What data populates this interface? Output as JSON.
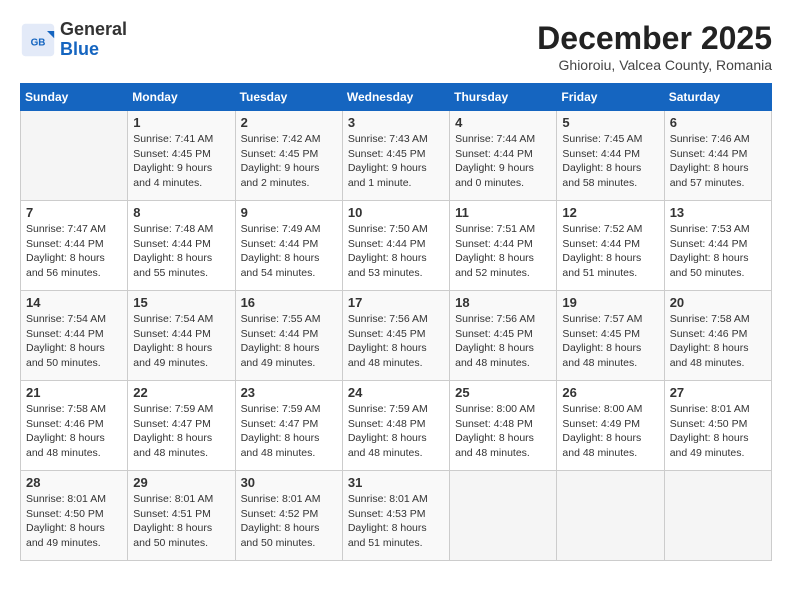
{
  "header": {
    "logo_general": "General",
    "logo_blue": "Blue",
    "month_title": "December 2025",
    "location": "Ghioroiu, Valcea County, Romania"
  },
  "days_of_week": [
    "Sunday",
    "Monday",
    "Tuesday",
    "Wednesday",
    "Thursday",
    "Friday",
    "Saturday"
  ],
  "weeks": [
    [
      {
        "day": "",
        "info": ""
      },
      {
        "day": "1",
        "info": "Sunrise: 7:41 AM\nSunset: 4:45 PM\nDaylight: 9 hours\nand 4 minutes."
      },
      {
        "day": "2",
        "info": "Sunrise: 7:42 AM\nSunset: 4:45 PM\nDaylight: 9 hours\nand 2 minutes."
      },
      {
        "day": "3",
        "info": "Sunrise: 7:43 AM\nSunset: 4:45 PM\nDaylight: 9 hours\nand 1 minute."
      },
      {
        "day": "4",
        "info": "Sunrise: 7:44 AM\nSunset: 4:44 PM\nDaylight: 9 hours\nand 0 minutes."
      },
      {
        "day": "5",
        "info": "Sunrise: 7:45 AM\nSunset: 4:44 PM\nDaylight: 8 hours\nand 58 minutes."
      },
      {
        "day": "6",
        "info": "Sunrise: 7:46 AM\nSunset: 4:44 PM\nDaylight: 8 hours\nand 57 minutes."
      }
    ],
    [
      {
        "day": "7",
        "info": "Sunrise: 7:47 AM\nSunset: 4:44 PM\nDaylight: 8 hours\nand 56 minutes."
      },
      {
        "day": "8",
        "info": "Sunrise: 7:48 AM\nSunset: 4:44 PM\nDaylight: 8 hours\nand 55 minutes."
      },
      {
        "day": "9",
        "info": "Sunrise: 7:49 AM\nSunset: 4:44 PM\nDaylight: 8 hours\nand 54 minutes."
      },
      {
        "day": "10",
        "info": "Sunrise: 7:50 AM\nSunset: 4:44 PM\nDaylight: 8 hours\nand 53 minutes."
      },
      {
        "day": "11",
        "info": "Sunrise: 7:51 AM\nSunset: 4:44 PM\nDaylight: 8 hours\nand 52 minutes."
      },
      {
        "day": "12",
        "info": "Sunrise: 7:52 AM\nSunset: 4:44 PM\nDaylight: 8 hours\nand 51 minutes."
      },
      {
        "day": "13",
        "info": "Sunrise: 7:53 AM\nSunset: 4:44 PM\nDaylight: 8 hours\nand 50 minutes."
      }
    ],
    [
      {
        "day": "14",
        "info": "Sunrise: 7:54 AM\nSunset: 4:44 PM\nDaylight: 8 hours\nand 50 minutes."
      },
      {
        "day": "15",
        "info": "Sunrise: 7:54 AM\nSunset: 4:44 PM\nDaylight: 8 hours\nand 49 minutes."
      },
      {
        "day": "16",
        "info": "Sunrise: 7:55 AM\nSunset: 4:44 PM\nDaylight: 8 hours\nand 49 minutes."
      },
      {
        "day": "17",
        "info": "Sunrise: 7:56 AM\nSunset: 4:45 PM\nDaylight: 8 hours\nand 48 minutes."
      },
      {
        "day": "18",
        "info": "Sunrise: 7:56 AM\nSunset: 4:45 PM\nDaylight: 8 hours\nand 48 minutes."
      },
      {
        "day": "19",
        "info": "Sunrise: 7:57 AM\nSunset: 4:45 PM\nDaylight: 8 hours\nand 48 minutes."
      },
      {
        "day": "20",
        "info": "Sunrise: 7:58 AM\nSunset: 4:46 PM\nDaylight: 8 hours\nand 48 minutes."
      }
    ],
    [
      {
        "day": "21",
        "info": "Sunrise: 7:58 AM\nSunset: 4:46 PM\nDaylight: 8 hours\nand 48 minutes."
      },
      {
        "day": "22",
        "info": "Sunrise: 7:59 AM\nSunset: 4:47 PM\nDaylight: 8 hours\nand 48 minutes."
      },
      {
        "day": "23",
        "info": "Sunrise: 7:59 AM\nSunset: 4:47 PM\nDaylight: 8 hours\nand 48 minutes."
      },
      {
        "day": "24",
        "info": "Sunrise: 7:59 AM\nSunset: 4:48 PM\nDaylight: 8 hours\nand 48 minutes."
      },
      {
        "day": "25",
        "info": "Sunrise: 8:00 AM\nSunset: 4:48 PM\nDaylight: 8 hours\nand 48 minutes."
      },
      {
        "day": "26",
        "info": "Sunrise: 8:00 AM\nSunset: 4:49 PM\nDaylight: 8 hours\nand 48 minutes."
      },
      {
        "day": "27",
        "info": "Sunrise: 8:01 AM\nSunset: 4:50 PM\nDaylight: 8 hours\nand 49 minutes."
      }
    ],
    [
      {
        "day": "28",
        "info": "Sunrise: 8:01 AM\nSunset: 4:50 PM\nDaylight: 8 hours\nand 49 minutes."
      },
      {
        "day": "29",
        "info": "Sunrise: 8:01 AM\nSunset: 4:51 PM\nDaylight: 8 hours\nand 50 minutes."
      },
      {
        "day": "30",
        "info": "Sunrise: 8:01 AM\nSunset: 4:52 PM\nDaylight: 8 hours\nand 50 minutes."
      },
      {
        "day": "31",
        "info": "Sunrise: 8:01 AM\nSunset: 4:53 PM\nDaylight: 8 hours\nand 51 minutes."
      },
      {
        "day": "",
        "info": ""
      },
      {
        "day": "",
        "info": ""
      },
      {
        "day": "",
        "info": ""
      }
    ]
  ]
}
